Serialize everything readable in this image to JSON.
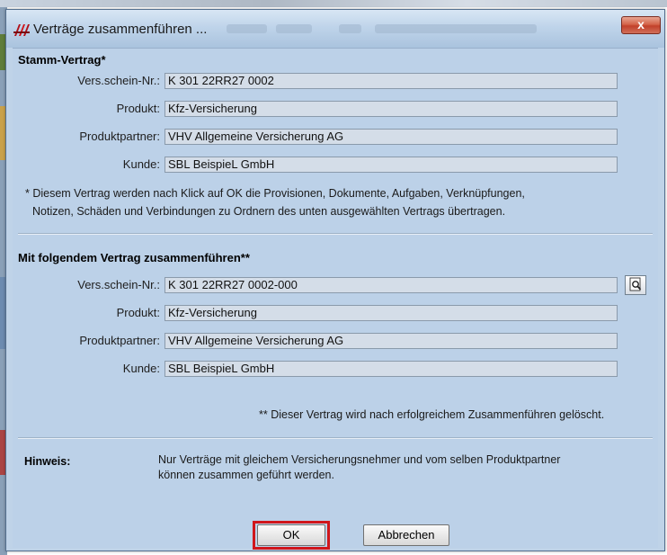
{
  "window": {
    "title": "Verträge zusammenführen ...",
    "close_symbol": "x"
  },
  "stamm": {
    "section_title": "Stamm-Vertrag*",
    "fields": [
      {
        "label": "Vers.schein-Nr.:",
        "value": "K 301 22RR27 0002"
      },
      {
        "label": "Produkt:",
        "value": "Kfz-Versicherung"
      },
      {
        "label": "Produktpartner:",
        "value": "VHV Allgemeine Versicherung AG"
      },
      {
        "label": "Kunde:",
        "value": "SBL BeispieL GmbH"
      }
    ],
    "note_line1": "* Diesem Vertrag werden nach Klick auf OK die Provisionen, Dokumente, Aufgaben, Verknüpfungen,",
    "note_line2": "Notizen, Schäden und Verbindungen zu Ordnern des unten ausgewählten Vertrags übertragen."
  },
  "target": {
    "section_title": "Mit folgendem Vertrag zusammenführen**",
    "fields": [
      {
        "label": "Vers.schein-Nr.:",
        "value": "K 301 22RR27 0002-000"
      },
      {
        "label": "Produkt:",
        "value": "Kfz-Versicherung"
      },
      {
        "label": "Produktpartner:",
        "value": "VHV Allgemeine Versicherung AG"
      },
      {
        "label": "Kunde:",
        "value": "SBL BeispieL GmbH"
      }
    ],
    "note": "** Dieser Vertrag wird nach erfolgreichem Zusammenführen gelöscht."
  },
  "hint": {
    "label": "Hinweis:",
    "line1": "Nur Verträge mit gleichem Versicherungsnehmer und vom selben Produktpartner",
    "line2": "können zusammen geführt werden."
  },
  "buttons": {
    "ok": "OK",
    "cancel": "Abbrechen"
  },
  "colors": {
    "highlight": "#d0161b",
    "dialog_bg": "#bcd1e8"
  },
  "icons": {
    "app": "app-logo-icon",
    "lookup": "search-document-icon"
  }
}
